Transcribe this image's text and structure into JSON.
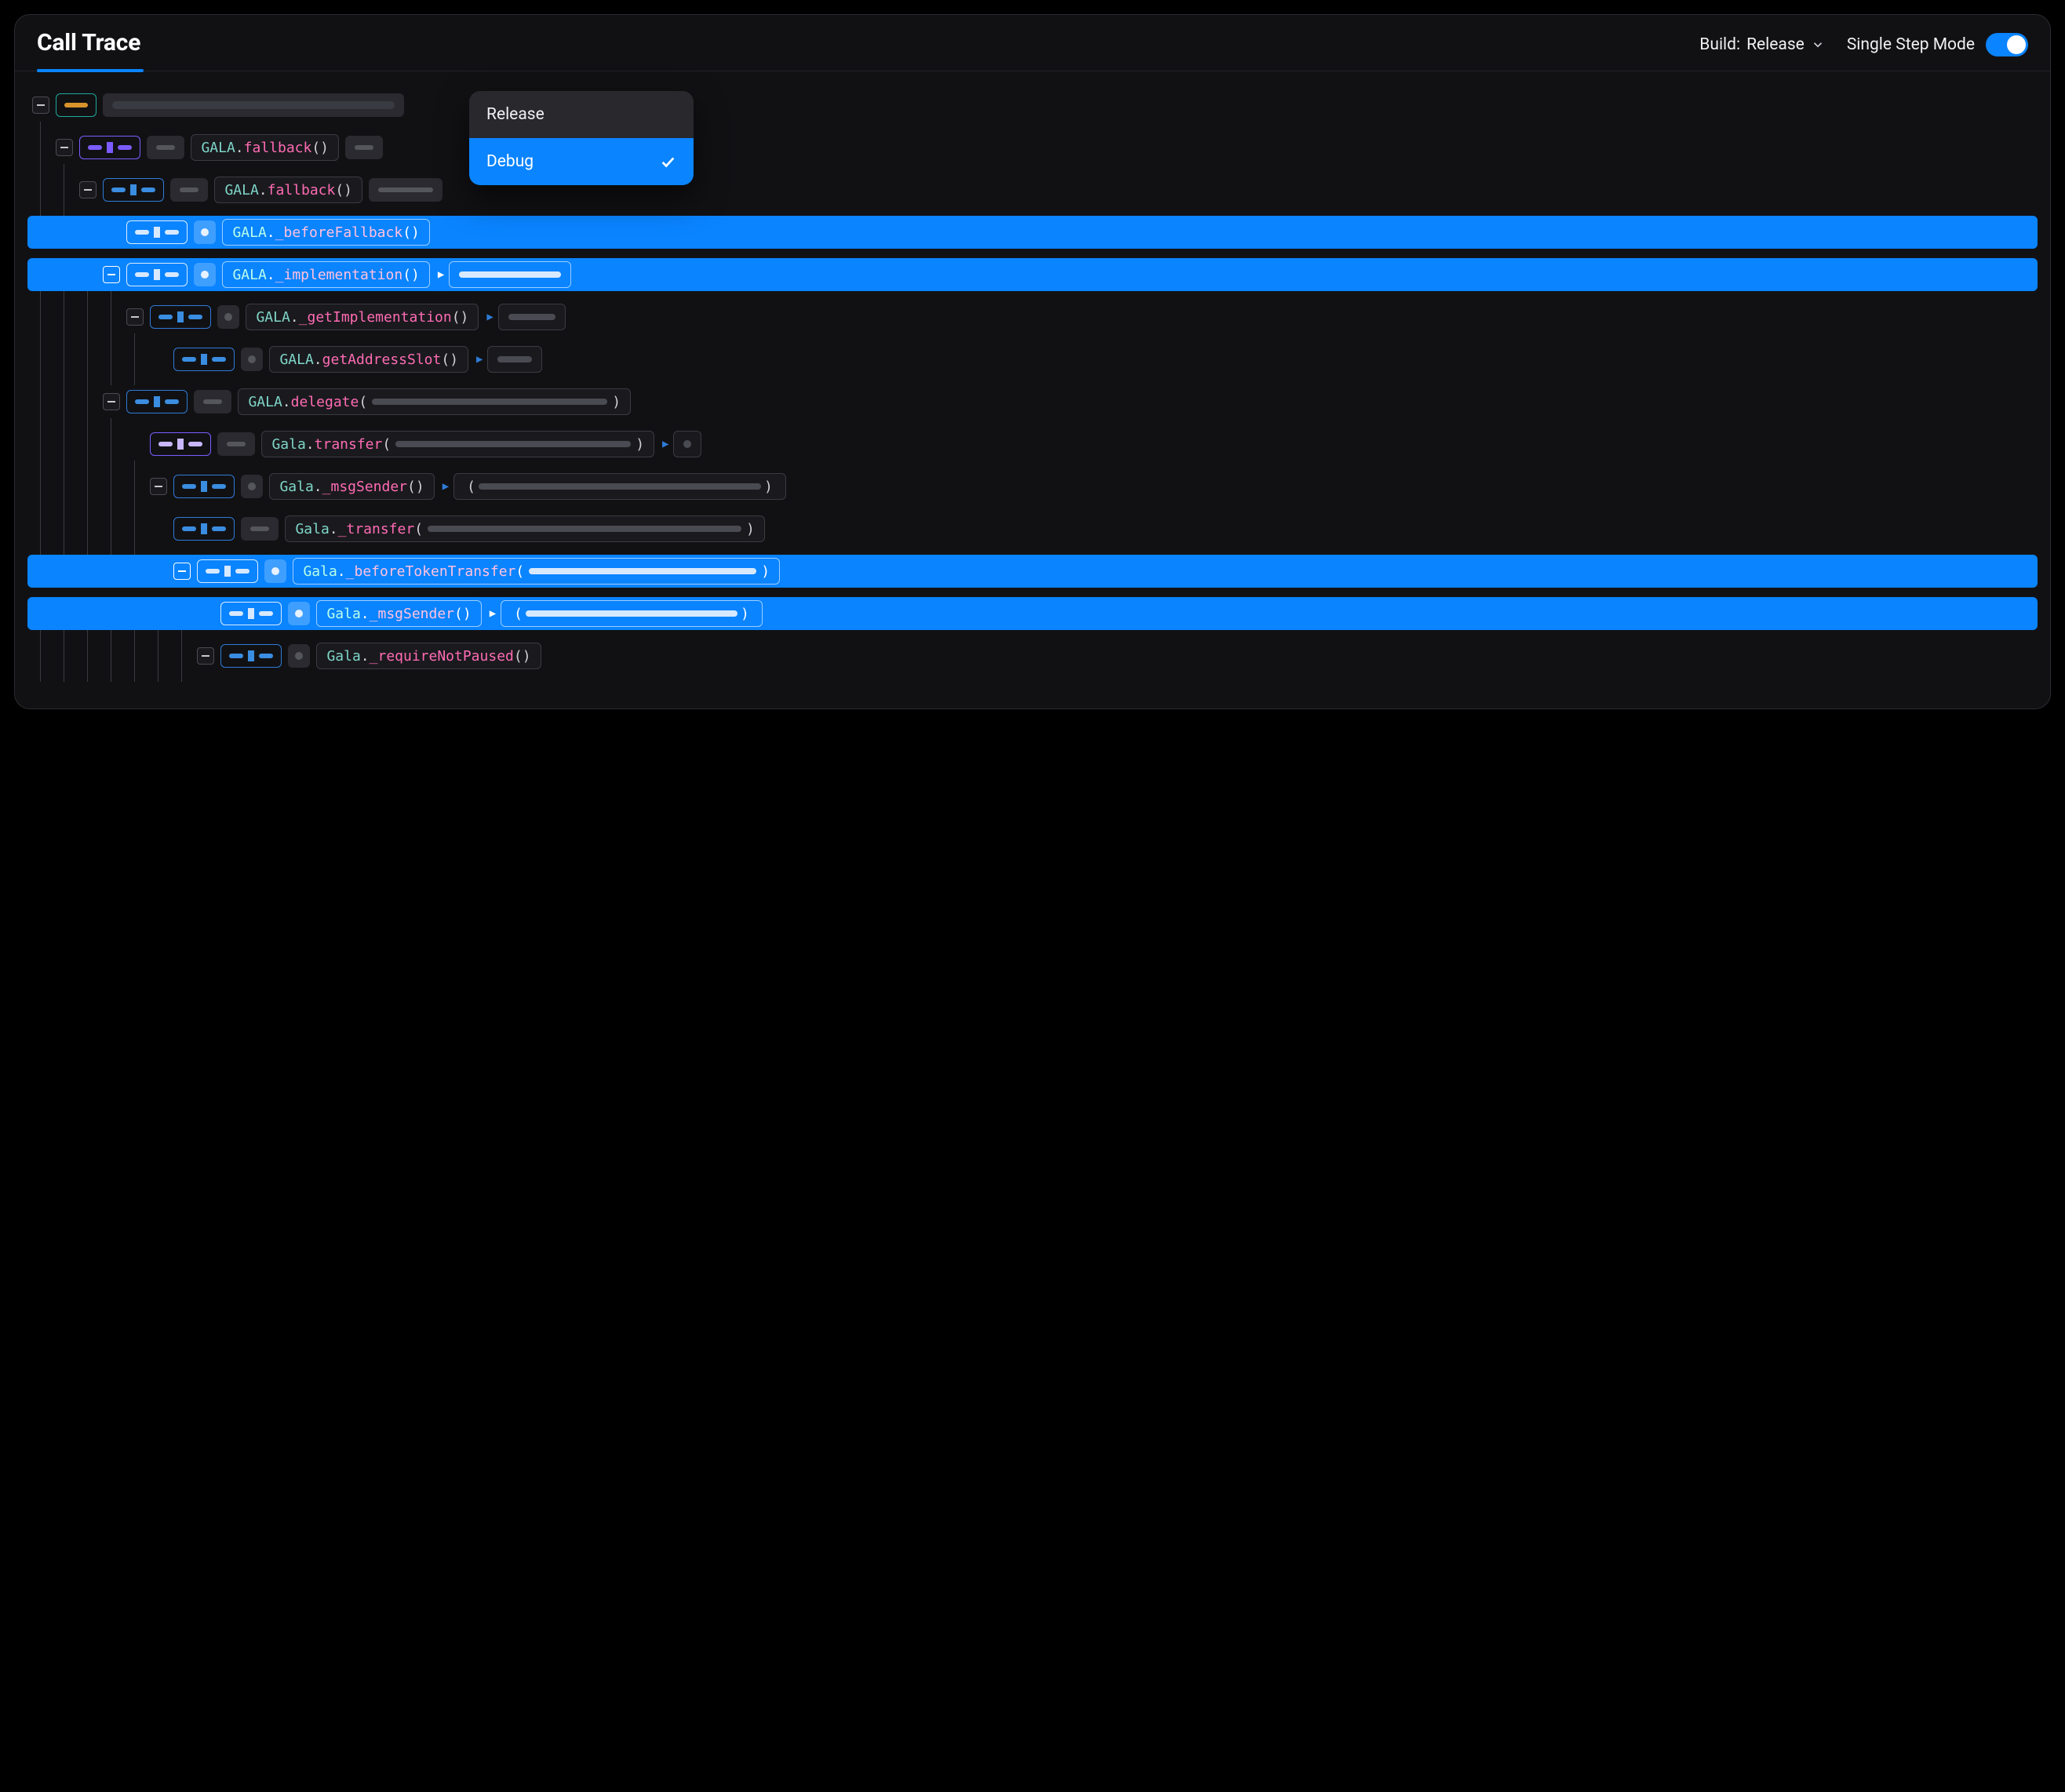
{
  "header": {
    "title": "Call Trace",
    "build_label": "Build:",
    "build_value": "Release",
    "single_step_label": "Single Step Mode",
    "single_step_on": true
  },
  "dropdown": {
    "options": [
      "Release",
      "Debug"
    ],
    "selected": "Debug"
  },
  "calls": {
    "fallback": {
      "ns": "GALA",
      "fn": "fallback"
    },
    "beforeFallback": {
      "ns": "GALA",
      "fn": "_beforeFallback"
    },
    "implementation": {
      "ns": "GALA",
      "fn": "_implementation"
    },
    "getImplementation": {
      "ns": "GALA",
      "fn": "_getImplementation"
    },
    "getAddressSlot": {
      "ns": "GALA",
      "fn": "getAddressSlot"
    },
    "delegate": {
      "ns": "GALA",
      "fn": "delegate"
    },
    "transfer": {
      "ns": "Gala",
      "fn": "transfer"
    },
    "msgSender": {
      "ns": "Gala",
      "fn": "_msgSender"
    },
    "_transfer": {
      "ns": "Gala",
      "fn": "_transfer"
    },
    "beforeTokenTransfer": {
      "ns": "Gala",
      "fn": "_beforeTokenTransfer"
    },
    "msgSender2": {
      "ns": "Gala",
      "fn": "_msgSender"
    },
    "requireNotPaused": {
      "ns": "Gala",
      "fn": "_requireNotPaused"
    }
  }
}
